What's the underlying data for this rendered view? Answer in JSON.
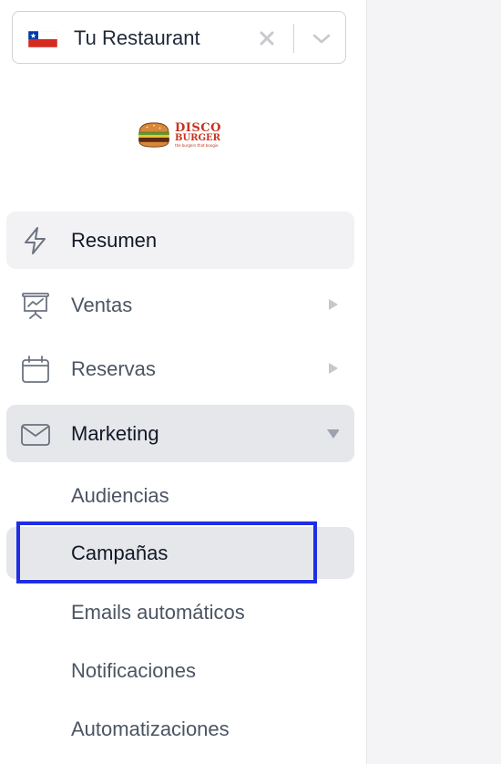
{
  "restaurant_select": {
    "value": "Tu Restaurant",
    "flag_icon": "chile-flag-icon",
    "clear_icon": "close-icon",
    "dropdown_icon": "chevron-down-icon"
  },
  "logo": {
    "line1": "DISCO",
    "line2": "BURGER",
    "tagline": "the burgers that boogie"
  },
  "nav": {
    "items": [
      {
        "label": "Resumen",
        "icon": "lightning-icon"
      },
      {
        "label": "Ventas",
        "icon": "presentation-chart-icon",
        "arrow": "caret-right-icon"
      },
      {
        "label": "Reservas",
        "icon": "calendar-icon",
        "arrow": "caret-right-icon"
      },
      {
        "label": "Marketing",
        "icon": "mail-icon",
        "arrow": "caret-down-icon"
      }
    ],
    "marketing_sub": [
      {
        "label": "Audiencias"
      },
      {
        "label": "Campañas"
      },
      {
        "label": "Emails automáticos"
      },
      {
        "label": "Notificaciones"
      },
      {
        "label": "Automatizaciones"
      }
    ]
  },
  "colors": {
    "accent_highlight": "#1f2ee6",
    "active_bg": "#e6e7ea",
    "logo_red": "#c7331f"
  }
}
